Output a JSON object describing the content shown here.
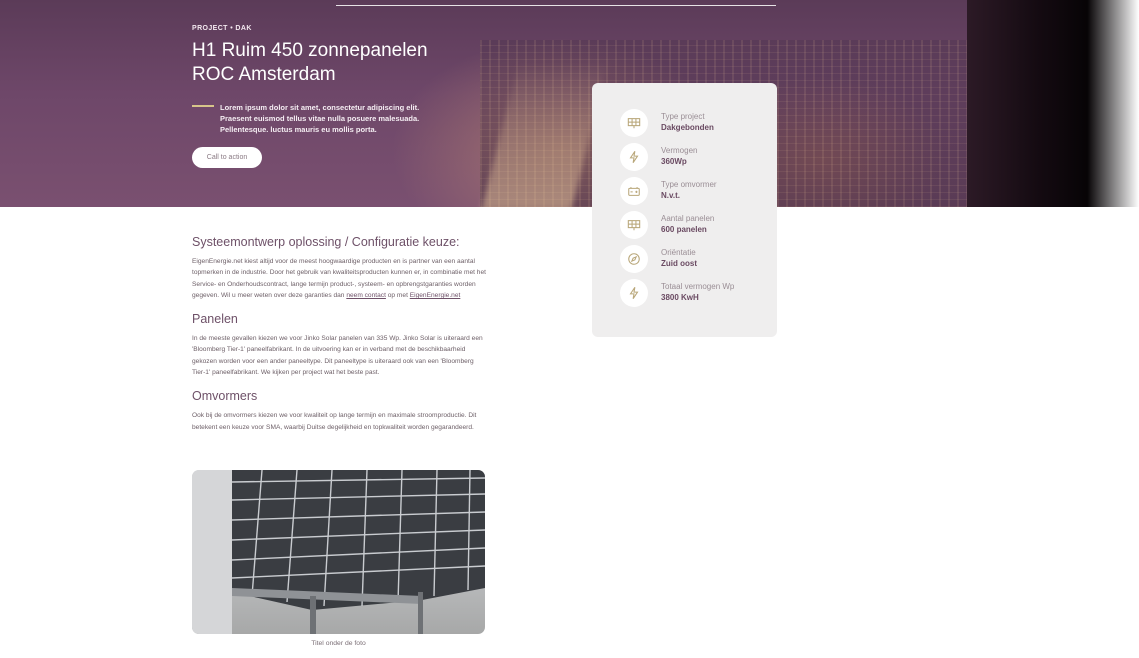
{
  "hero": {
    "eyebrow": "PROJECT • DAK",
    "title_line1": "H1 Ruim 450 zonnepanelen",
    "title_line2": "ROC Amsterdam",
    "intro_line1": "Lorem ipsum dolor sit amet, consectetur adipiscing elit.",
    "intro_line2": "Praesent euismod tellus vitae nulla posuere malesuada.",
    "intro_line3": "Pellentesque. luctus mauris eu mollis porta.",
    "cta_label": "Call to action"
  },
  "specs": [
    {
      "icon": "solar-panel-icon",
      "label": "Type project",
      "value": "Dakgebonden"
    },
    {
      "icon": "lightning-icon",
      "label": "Vermogen",
      "value": "360Wp"
    },
    {
      "icon": "battery-icon",
      "label": "Type omvormer",
      "value": "N.v.t."
    },
    {
      "icon": "solar-panel-icon",
      "label": "Aantal panelen",
      "value": "600 panelen"
    },
    {
      "icon": "compass-icon",
      "label": "Oriëntatie",
      "value": "Zuid oost"
    },
    {
      "icon": "lightning-icon",
      "label": "Totaal vermogen Wp",
      "value": "3800 KwH"
    }
  ],
  "sections": {
    "system": {
      "title": "Systeemontwerp oplossing / Configuratie keuze:",
      "text_1": "EigenEnergie.net kiest altijd voor de meest hoogwaardige producten en is partner van een aantal topmerken in de industrie. Door het gebruik van kwaliteitsproducten kunnen er, in combinatie met het Service- en Onderhoudscontract, lange termijn product-, systeem- en opbrengstgaranties worden gegeven. Wil u meer weten over deze garanties dan ",
      "link_contact": "neem contact",
      "text_2": " op met ",
      "link_site": "EigenEnergie.net"
    },
    "panels": {
      "title": "Panelen",
      "text": "In de meeste gevallen kiezen we voor Jinko Solar panelen van 335 Wp. Jinko Solar is uiteraard een 'Bloomberg Tier-1' paneelfabrikant. In de uitvoering kan er in verband met de beschikbaarheid gekozen worden voor een ander paneeltype. Dit paneeltype is uiteraard ook van een 'Bloomberg Tier-1' paneelfabrikant. We kijken per project wat het beste past."
    },
    "inverters": {
      "title": "Omvormers",
      "text": "Ook bij de omvormers kiezen we voor kwaliteit op lange termijn en maximale stroomproductie. Dit betekent een keuze voor SMA, waarbij Duitse degelijkheid en topkwaliteit worden gegarandeerd."
    }
  },
  "photo": {
    "caption": "Titel onder de foto"
  }
}
